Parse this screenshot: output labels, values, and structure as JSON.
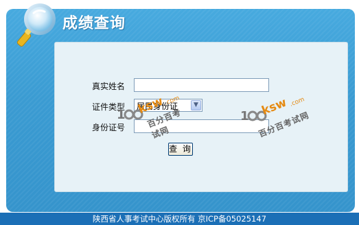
{
  "header": {
    "title": "成绩查询",
    "icon": "magnifier-icon"
  },
  "form": {
    "name_label": "真实姓名",
    "name_value": "",
    "id_type_label": "证件类型",
    "id_type_selected": "居民身份证",
    "id_number_label": "身份证号",
    "id_number_value": "",
    "submit_label": "查 询"
  },
  "footer": {
    "text": "陕西省人事考试中心版权所有 京ICP备05025147"
  },
  "watermark": {
    "brand": "ksw",
    "domain": ".com",
    "chinese": "百分百考试网"
  },
  "colors": {
    "panel": "#3b9ed4",
    "inner": "#e7f2f7",
    "footer": "#1b6fb6",
    "title": "#ffffff"
  }
}
